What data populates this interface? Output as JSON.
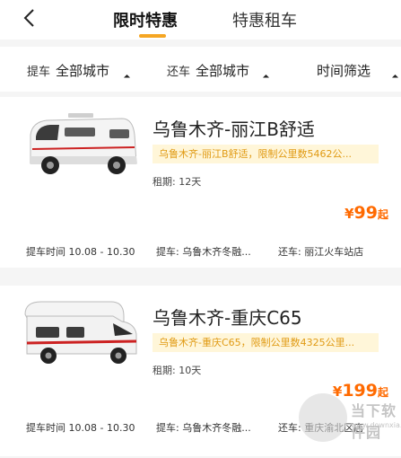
{
  "header": {
    "tabs": [
      {
        "label": "限时特惠",
        "active": true
      },
      {
        "label": "特惠租车",
        "active": false
      }
    ]
  },
  "filters": {
    "pickup_label": "提车",
    "pickup_value": "全部城市",
    "return_label": "还车",
    "return_value": "全部城市",
    "time_filter": "时间筛选"
  },
  "cards": [
    {
      "title": "乌鲁木齐-丽江B舒适",
      "note": "乌鲁木齐-丽江B舒适，限制公里数5462公...",
      "period": "租期: 12天",
      "price_symbol": "¥",
      "price": "99",
      "price_suffix": "起",
      "pickup_time": "提车时间 10.08 - 10.30",
      "pickup_place": "提车: 乌鲁木齐冬融...",
      "return_place": "还车: 丽江火车站店"
    },
    {
      "title": "乌鲁木齐-重庆C65",
      "note": "乌鲁木齐-重庆C65，限制公里数4325公里...",
      "period": "租期: 10天",
      "price_symbol": "¥",
      "price": "199",
      "price_suffix": "起",
      "pickup_time": "提车时间 10.08 - 10.30",
      "pickup_place": "提车: 乌鲁木齐冬融...",
      "return_place": "还车: 重庆渝北区店"
    }
  ],
  "watermark": {
    "text": "当下软件园",
    "url": "www.downxia.com"
  },
  "colors": {
    "accent": "#f5a623",
    "price": "#ff6a00",
    "note_bg": "#fff6d9",
    "note_text": "#e09a13"
  }
}
